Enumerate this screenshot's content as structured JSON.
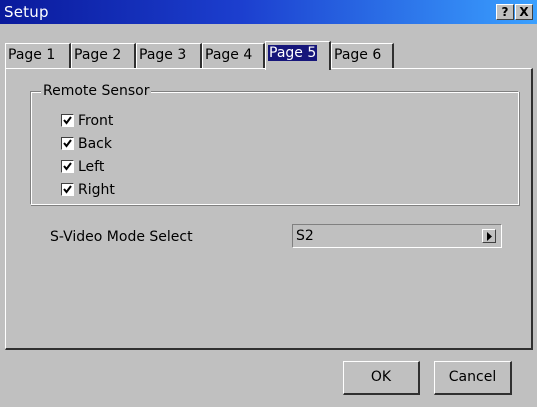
{
  "window": {
    "title": "Setup",
    "help_button": "?",
    "close_button": "X"
  },
  "tabs": [
    {
      "label": "Page 1",
      "active": false
    },
    {
      "label": "Page 2",
      "active": false
    },
    {
      "label": "Page 3",
      "active": false
    },
    {
      "label": "Page 4",
      "active": false
    },
    {
      "label": "Page 5",
      "active": true
    },
    {
      "label": "Page 6",
      "active": false
    }
  ],
  "remote_sensor": {
    "group_label": "Remote Sensor",
    "options": [
      {
        "label": "Front",
        "checked": true
      },
      {
        "label": "Back",
        "checked": true
      },
      {
        "label": "Left",
        "checked": true
      },
      {
        "label": "Right",
        "checked": true
      }
    ]
  },
  "svideo": {
    "label": "S-Video Mode Select",
    "value": "S2",
    "arrow_icon": "triangle-right-icon"
  },
  "buttons": {
    "ok": "OK",
    "cancel": "Cancel"
  },
  "colors": {
    "title_bar_start": "#0a1a9c",
    "title_bar_end": "#3aa0ff",
    "active_tab_highlight": "#16167a",
    "face": "#c0c0c0"
  }
}
